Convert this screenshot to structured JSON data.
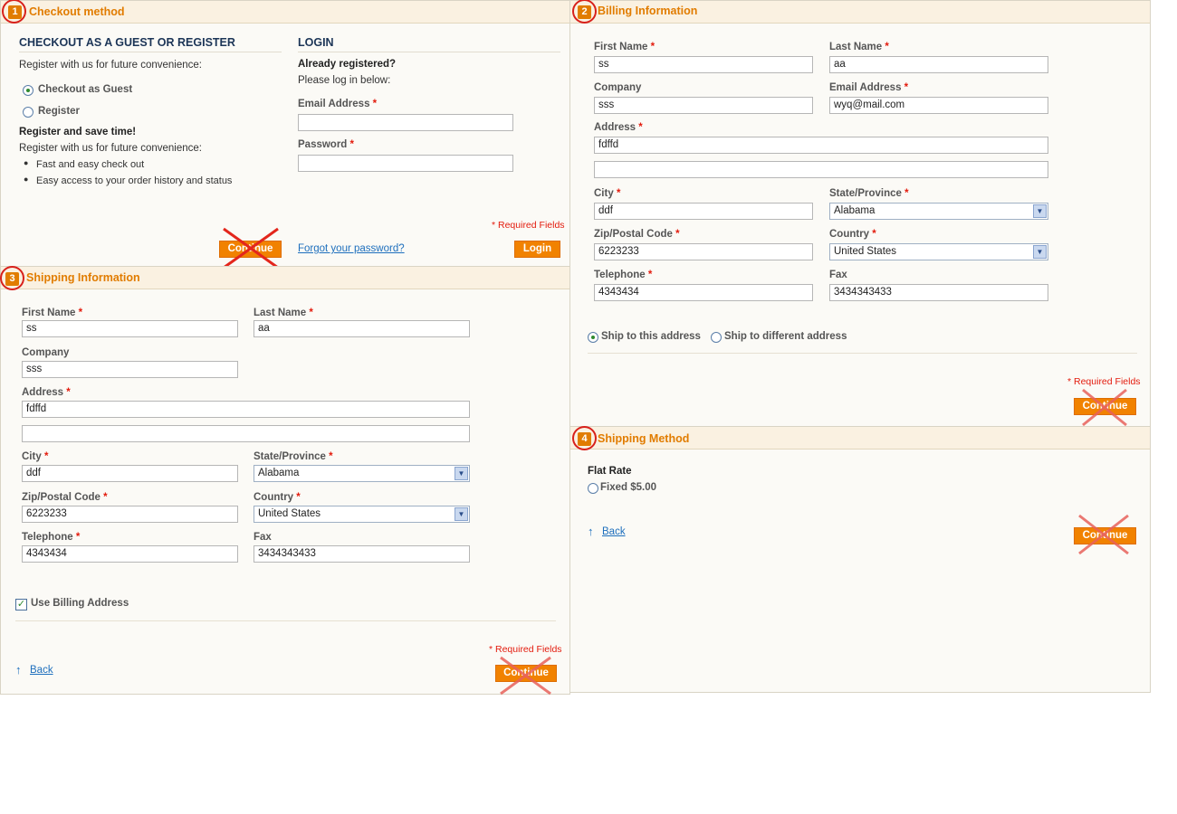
{
  "step1": {
    "number": "1",
    "title": "Checkout method",
    "guest_heading": "CHECKOUT AS A GUEST OR REGISTER",
    "guest_intro": "Register with us for future convenience:",
    "option_guest": "Checkout as Guest",
    "option_register": "Register",
    "save_heading": "Register and save time!",
    "save_intro": "Register with us for future convenience:",
    "benefits": [
      "Fast and easy check out",
      "Easy access to your order history and status"
    ],
    "continue_label": "Continue",
    "login_heading": "LOGIN",
    "already_registered": "Already registered?",
    "please_login": "Please log in below:",
    "email_label": "Email Address",
    "email_value": "",
    "password_label": "Password",
    "password_value": "",
    "required_note": "* Required Fields",
    "forgot_link": "Forgot your password?",
    "login_label": "Login"
  },
  "step2": {
    "number": "2",
    "title": "Billing Information",
    "first_name_label": "First Name",
    "first_name": "ss",
    "last_name_label": "Last Name",
    "last_name": "aa",
    "company_label": "Company",
    "company": "sss",
    "email_label": "Email Address",
    "email": "wyq@mail.com",
    "address_label": "Address",
    "address1": "fdffd",
    "address2": "",
    "city_label": "City",
    "city": "ddf",
    "state_label": "State/Province",
    "state": "Alabama",
    "zip_label": "Zip/Postal Code",
    "zip": "6223233",
    "country_label": "Country",
    "country": "United States",
    "telephone_label": "Telephone",
    "telephone": "4343434",
    "fax_label": "Fax",
    "fax": "3434343433",
    "ship_this": "Ship to this address",
    "ship_different": "Ship to different address",
    "required_note": "* Required Fields",
    "continue_label": "Continue"
  },
  "step3": {
    "number": "3",
    "title": "Shipping Information",
    "first_name_label": "First Name",
    "first_name": "ss",
    "last_name_label": "Last Name",
    "last_name": "aa",
    "company_label": "Company",
    "company": "sss",
    "address_label": "Address",
    "address1": "fdffd",
    "address2": "",
    "city_label": "City",
    "city": "ddf",
    "state_label": "State/Province",
    "state": "Alabama",
    "zip_label": "Zip/Postal Code",
    "zip": "6223233",
    "country_label": "Country",
    "country": "United States",
    "telephone_label": "Telephone",
    "telephone": "4343434",
    "fax_label": "Fax",
    "fax": "3434343433",
    "use_billing": "Use Billing Address",
    "required_note": "* Required Fields",
    "back_label": "Back",
    "continue_label": "Continue"
  },
  "step4": {
    "number": "4",
    "title": "Shipping Method",
    "carrier": "Flat Rate",
    "option": "Fixed $5.00",
    "back_label": "Back",
    "continue_label": "Continue"
  },
  "required_star": "*",
  "colors": {
    "accent": "#e17c00",
    "button": "#f18200",
    "required": "#e31b0d",
    "link": "#1e6fbd",
    "annotation": "#d8201b"
  }
}
